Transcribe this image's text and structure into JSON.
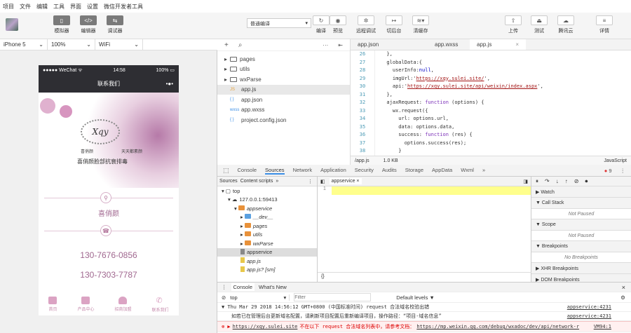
{
  "menu": [
    "项目",
    "文件",
    "编辑",
    "工具",
    "界面",
    "设置",
    "微信开发者工具"
  ],
  "toolbar": {
    "simulator": "模拟器",
    "editor": "编辑器",
    "debugger": "调试器",
    "compile_mode": "普通编译",
    "compile": "编译",
    "preview": "预览",
    "remote_debug": "远程调试",
    "background": "切后台",
    "clear_cache": "清缓存",
    "upload": "上传",
    "test": "测试",
    "tencent_cloud": "腾讯云",
    "details": "详情"
  },
  "sim": {
    "device": "iPhone 5",
    "zoom": "100%",
    "network": "WiFi"
  },
  "phone": {
    "carrier": "●●●●● WeChat ᯤ",
    "time": "14:58",
    "battery": "100%",
    "nav_title": "联系我们",
    "more": "•●•",
    "brand_line1": "喜俏颜",
    "brand_line2": "天天都素颜",
    "banner_slogan": "喜俏颜脸部抗衰排毒",
    "logo": "Xqy",
    "shop_name": "喜俏颜",
    "phone1": "130-7676-0856",
    "phone2": "130-7303-7787",
    "tabs": [
      "首页",
      "产品中心",
      "招商加盟",
      "联系我们"
    ]
  },
  "tree": {
    "items": [
      {
        "label": "pages",
        "type": "folder"
      },
      {
        "label": "utils",
        "type": "folder"
      },
      {
        "label": "wxParse",
        "type": "folder"
      },
      {
        "label": "app.js",
        "type": "js",
        "icon": "JS"
      },
      {
        "label": "app.json",
        "type": "json",
        "icon": "{ }"
      },
      {
        "label": "app.wxss",
        "type": "wxss",
        "icon": "wxss"
      },
      {
        "label": "project.config.json",
        "type": "json",
        "icon": "{ }"
      }
    ]
  },
  "editor": {
    "tabs": [
      "app.json",
      "app.wxss",
      "app.js"
    ],
    "status_path": "/app.js",
    "status_size": "1.0 KB",
    "status_lang": "JavaScript",
    "lines": [
      {
        "n": "26",
        "html": "  },"
      },
      {
        "n": "27",
        "html": "  globalData:{"
      },
      {
        "n": "28",
        "html": "    userInfo:<span class='nul'>null</span>,"
      },
      {
        "n": "29",
        "html": "    imgUrl:'<span class='str'>https://xqy.sulei.site/</span>',"
      },
      {
        "n": "30",
        "html": "    api:'<span class='str'>https://xqy.sulei.site/api/weixin/index.aspx</span>',"
      },
      {
        "n": "31",
        "html": "  },"
      },
      {
        "n": "32",
        "html": "  ajaxRequest: <span class='kw'>function</span> (options) {"
      },
      {
        "n": "33",
        "html": "    wx.request({"
      },
      {
        "n": "34",
        "html": "      url: options.url,"
      },
      {
        "n": "35",
        "html": "      data: options.data,"
      },
      {
        "n": "36",
        "html": "      success: <span class='kw'>function</span> (res) {"
      },
      {
        "n": "37",
        "html": "        options.success(res);"
      },
      {
        "n": "38",
        "html": "      }"
      }
    ]
  },
  "devtools": {
    "tabs": [
      "Console",
      "Sources",
      "Network",
      "Application",
      "Security",
      "Audits",
      "Storage",
      "AppData",
      "Wxml",
      "»"
    ],
    "error_count": "9",
    "sources_tabs": [
      "Sources",
      "Content scripts",
      "»"
    ],
    "tree": [
      {
        "label": "top",
        "indent": 0
      },
      {
        "label": "127.0.0.1:59413",
        "indent": 1
      },
      {
        "label": "appservice",
        "indent": 2,
        "folder": true
      },
      {
        "label": "__dev__",
        "indent": 3,
        "folder": true
      },
      {
        "label": "pages",
        "indent": 3,
        "folder": true
      },
      {
        "label": "utils",
        "indent": 3,
        "folder": true
      },
      {
        "label": "wxParse",
        "indent": 3,
        "folder": true
      },
      {
        "label": "appservice",
        "indent": 3,
        "file": true
      },
      {
        "label": "app.js",
        "indent": 3,
        "file": true
      },
      {
        "label": "app.js? [sm]",
        "indent": 3,
        "file": true
      }
    ],
    "open_file": "appservice",
    "line_no": "1",
    "format": "{}",
    "sections": [
      {
        "title": "▶ Watch"
      },
      {
        "title": "▼ Call Stack",
        "body": "Not Paused"
      },
      {
        "title": "▼ Scope",
        "body": "Not Paused"
      },
      {
        "title": "▼ Breakpoints",
        "body": "No Breakpoints"
      },
      {
        "title": "▶ XHR Breakpoints"
      },
      {
        "title": "▶ DOM Breakpoints"
      }
    ]
  },
  "console": {
    "tabs": [
      "Console",
      "What's New"
    ],
    "context": "top",
    "filter_placeholder": "Filter",
    "levels": "Default levels ▼",
    "msg1": "▼ Thu Mar 29 2018 14:56:12 GMT+0800 (中国标准时间) request 合法域名校验出错",
    "src1": "appservice:4231",
    "msg2": "如若已在管理后台更新域名配置，请刷新项目配置后重新编译项目，操作路径：“项目-域名信息”",
    "src2": "appservice:4231",
    "err_url": "https://xqy.sulei.site",
    "err_text": " 不在以下 request 合法域名列表中，请参考文档：",
    "err_link": "https://mp.weixin.qq.com/debug/wxadoc/dev/api/network-r",
    "err_src": "VM94:1"
  }
}
